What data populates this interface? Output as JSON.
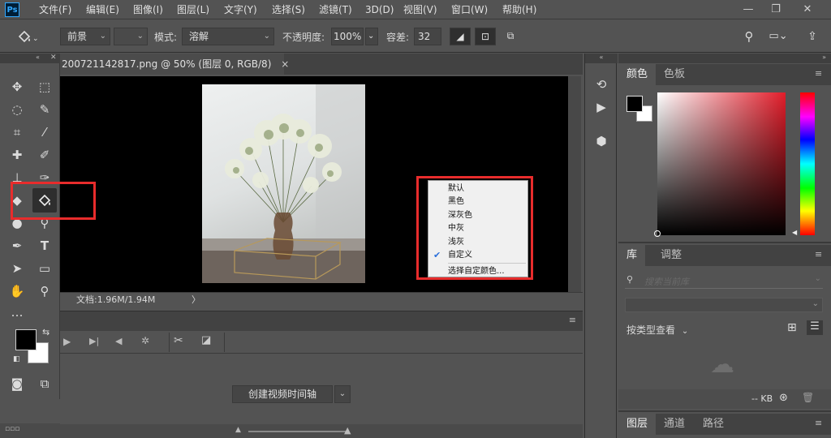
{
  "app": {
    "logo": "Ps"
  },
  "menubar": {
    "items": [
      "文件(F)",
      "编辑(E)",
      "图像(I)",
      "图层(L)",
      "文字(Y)",
      "选择(S)",
      "滤镜(T)",
      "3D(D)",
      "视图(V)",
      "窗口(W)",
      "帮助(H)"
    ],
    "window_controls": [
      "minimize-icon",
      "restore-icon",
      "close-icon"
    ]
  },
  "options": {
    "fill_source": "前景",
    "mode_label": "模式:",
    "mode_value": "溶解",
    "opacity_label": "不透明度:",
    "opacity_value": "100%",
    "tolerance_label": "容差:",
    "tolerance_value": "32"
  },
  "document": {
    "tab_title": "200721142817.png @ 50% (图层 0, RGB/8)",
    "tab_close": "×",
    "status": "文档:1.96M/1.94M",
    "status_arrow": "〉"
  },
  "context_menu": {
    "items": [
      "默认",
      "黑色",
      "深灰色",
      "中灰",
      "浅灰",
      "自定义",
      "选择自定颜色..."
    ],
    "checked_index": 5,
    "check_mark": "✔"
  },
  "timeline": {
    "create_button": "创建视频时间轴",
    "dropdown": "⌄"
  },
  "color_panel": {
    "tabs": [
      "颜色",
      "色板"
    ],
    "active_tab": 0,
    "foreground": "#000000",
    "background": "#ffffff",
    "hue_color": "#e11d2a"
  },
  "library_panel": {
    "tabs": [
      "库",
      "调整"
    ],
    "active_tab": 0,
    "search_placeholder": "搜索当前库",
    "view_by": "按类型查看",
    "size": "-- KB"
  },
  "layers_panel": {
    "tabs": [
      "图层",
      "通道",
      "路径"
    ],
    "active_tab": 0
  },
  "colors": {
    "ui_bg": "#535353",
    "highlight": "#e82c2c",
    "check": "#2a6fdb"
  }
}
